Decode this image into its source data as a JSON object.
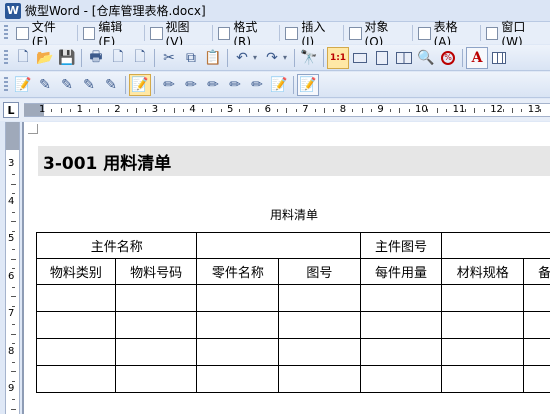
{
  "window": {
    "title": "微型Word - [仓库管理表格.docx]",
    "app_icon": "W"
  },
  "menubar": {
    "items": [
      {
        "label": "文件(F)",
        "icon": "file-menu-icon"
      },
      {
        "label": "编辑(E)",
        "icon": "edit-menu-icon"
      },
      {
        "label": "视图(V)",
        "icon": "view-menu-icon"
      },
      {
        "label": "格式(R)",
        "icon": "format-menu-icon"
      },
      {
        "label": "插入(I)",
        "icon": "insert-menu-icon"
      },
      {
        "label": "对象(O)",
        "icon": "object-menu-icon"
      },
      {
        "label": "表格(A)",
        "icon": "table-menu-icon"
      },
      {
        "label": "窗口(W)",
        "icon": "window-menu-icon"
      }
    ]
  },
  "toolbar1": {
    "glyph_new": "🗋",
    "glyph_open": "📂",
    "glyph_save": "💾",
    "glyph_print": "🖶",
    "glyph_cut": "✂",
    "glyph_copy": "⧉",
    "glyph_paste": "📋",
    "glyph_undo": "↶",
    "glyph_redo": "↷",
    "glyph_find": "🔭",
    "zoom_label": "1:1",
    "glyph_zoom": "🔍",
    "glyph_letter": "A",
    "dropdown_glyph": "▾"
  },
  "toolbar2": {
    "glyph_pen": "✎",
    "glyph_highlight": "✏",
    "glyph_stamp": "📝"
  },
  "ruler": {
    "corner_glyph": "L",
    "h_labels": [
      "1",
      "1",
      "2",
      "3",
      "4",
      "5",
      "6",
      "7",
      "8",
      "9",
      "10",
      "11",
      "12",
      "13"
    ],
    "v_labels": [
      "3",
      "4",
      "5",
      "6",
      "7",
      "8",
      "9"
    ]
  },
  "document": {
    "heading": "3-001    用料清单",
    "table_caption": "用料清单",
    "table": {
      "row1": [
        "主件名称",
        "",
        "主件图号",
        ""
      ],
      "headers": [
        "物料类别",
        "物料号码",
        "零件名称",
        "图号",
        "每件用量",
        "材料规格",
        "备"
      ],
      "empty_rows": 4
    }
  }
}
